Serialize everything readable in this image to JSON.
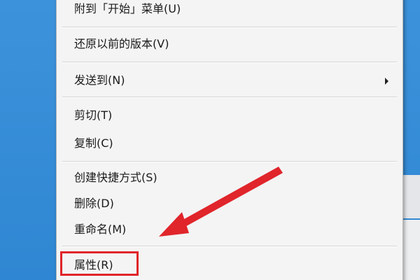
{
  "context_menu": {
    "items": [
      {
        "label": "附到「开始」菜单(U)"
      },
      {
        "label": "还原以前的版本(V)"
      },
      {
        "label": "发送到(N)",
        "has_submenu": true
      },
      {
        "label": "剪切(T)"
      },
      {
        "label": "复制(C)"
      },
      {
        "label": "创建快捷方式(S)"
      },
      {
        "label": "删除(D)"
      },
      {
        "label": "重命名(M)"
      },
      {
        "label": "属性(R)",
        "highlighted": true
      }
    ]
  },
  "annotation": {
    "highlight_color": "#e0252b",
    "arrow_icon": "red-arrow-icon"
  },
  "colors": {
    "menu_background": "#f4f4f4",
    "desktop_background": "#3a8fd8"
  }
}
